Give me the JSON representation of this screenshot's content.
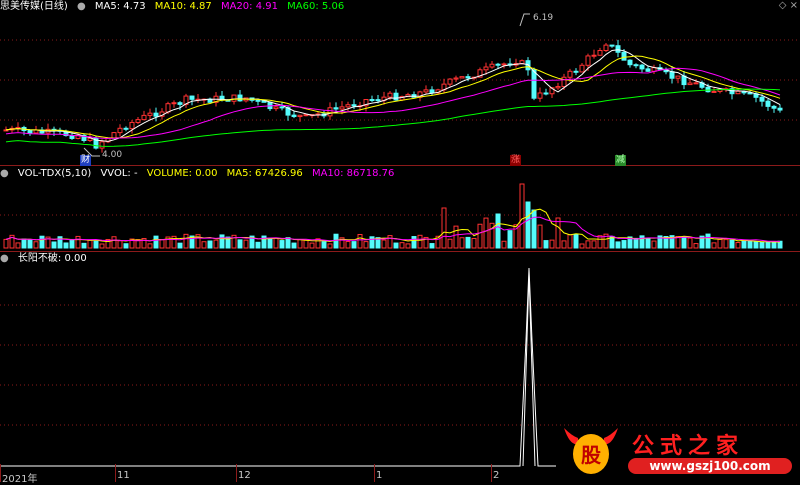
{
  "header": {
    "stock_name": "思美传媒(日线)",
    "items": [
      {
        "label": "MA5: 4.73",
        "color": "#ffffff"
      },
      {
        "label": "MA10: 4.87",
        "color": "#ffff00"
      },
      {
        "label": "MA20: 4.91",
        "color": "#ff00ff"
      },
      {
        "label": "MA60: 5.06",
        "color": "#00ff00"
      }
    ]
  },
  "price_annotations": {
    "high": "6.19",
    "low": "4.00"
  },
  "badges": {
    "cai": "财",
    "zhang": "涨",
    "jian": "减"
  },
  "volume_header": {
    "name": "VOL-TDX(5,10)",
    "vvol": "VVOL: -",
    "items": [
      {
        "label": "VOLUME: 0.00",
        "color": "#ffff00"
      },
      {
        "label": "MA5: 67426.96",
        "color": "#ffff00"
      },
      {
        "label": "MA10: 86718.76",
        "color": "#ff00ff"
      }
    ]
  },
  "indicator_header": {
    "name": "长阳不破",
    "value": ": 0.00"
  },
  "x_axis": {
    "labels": [
      "2021年",
      "11",
      "12",
      "1",
      "2"
    ]
  },
  "logo": {
    "icon": "ox-head-icon",
    "title": "公式之家",
    "url": "www.gszj100.com",
    "ox_text": "股"
  },
  "colors": {
    "up": "#ff3232",
    "down": "#54fcfc",
    "ma5": "#ffffff",
    "ma10": "#ffff00",
    "ma20": "#ff00ff",
    "ma60": "#00ff00",
    "separator": "#8b1a1a"
  }
}
